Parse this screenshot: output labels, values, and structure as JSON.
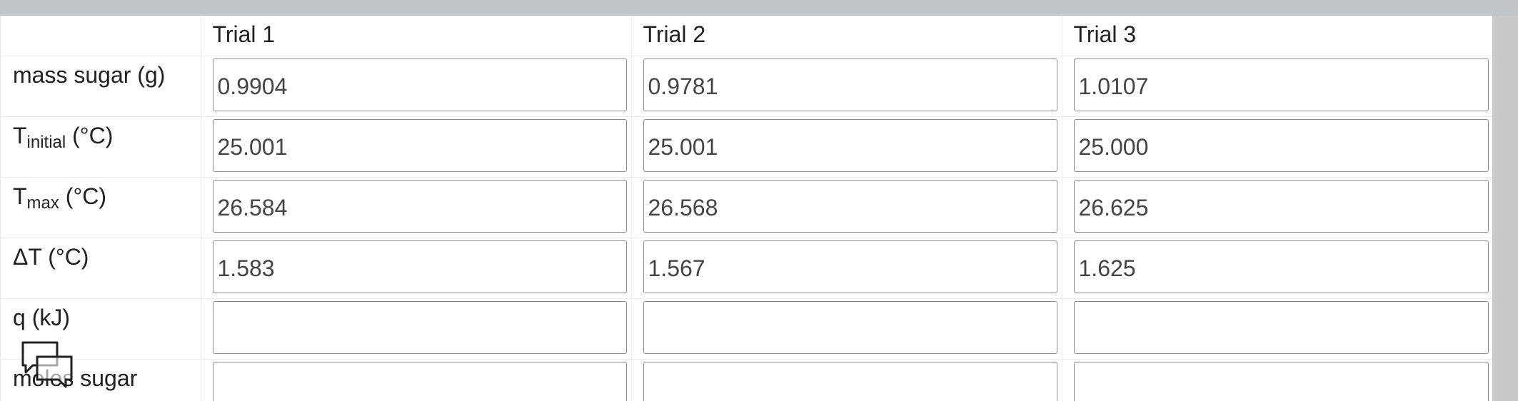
{
  "table": {
    "headers": [
      "",
      "Trial 1",
      "Trial 2",
      "Trial 3"
    ],
    "rows": [
      {
        "label": "mass sugar (g)",
        "values": [
          "0.9904",
          "0.9781",
          "1.0107"
        ]
      },
      {
        "label_main": "T",
        "label_sub": "initial",
        "label_unit": " (°C)",
        "values": [
          "25.001",
          "25.001",
          "25.000"
        ]
      },
      {
        "label_main": "T",
        "label_sub": "max",
        "label_unit": " (°C)",
        "values": [
          "26.584",
          "26.568",
          "26.625"
        ]
      },
      {
        "label": "ΔT (°C)",
        "values": [
          "1.583",
          "1.567",
          "1.625"
        ]
      },
      {
        "label": "q (kJ)",
        "values": [
          "",
          "",
          ""
        ]
      },
      {
        "label": "moles sugar",
        "values": [
          "",
          "",
          ""
        ]
      }
    ]
  },
  "chat_icon": "chat-bubbles-icon"
}
